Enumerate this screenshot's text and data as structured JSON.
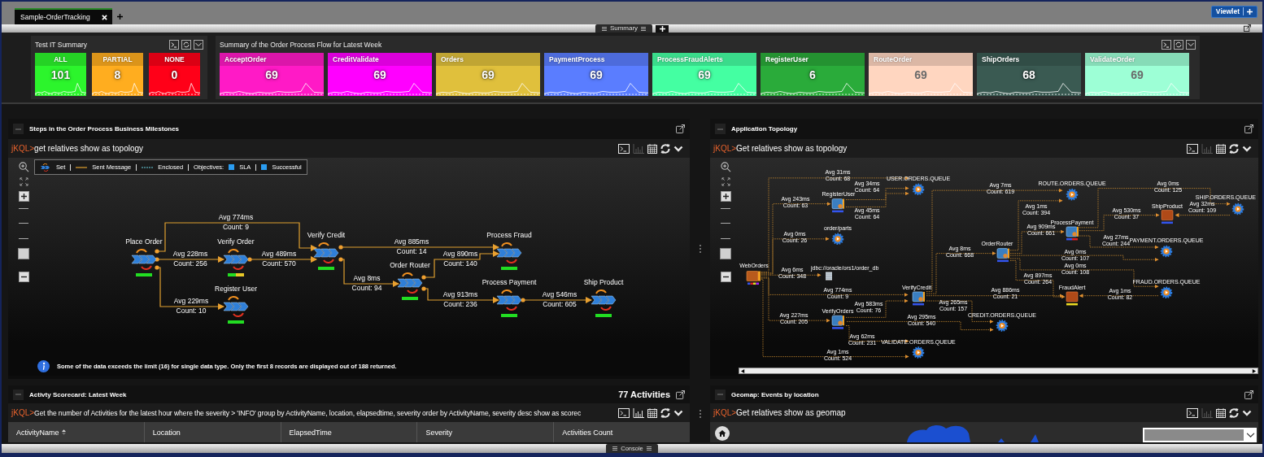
{
  "tabs": [
    {
      "label": "Sample-OrderTracking",
      "selected": true
    }
  ],
  "viewlet_button": "Viewlet",
  "layout_tab": "Summary",
  "summary": {
    "it": {
      "title": "Test IT Summary",
      "tiles": [
        {
          "label": "ALL",
          "value": "101",
          "color": "#2cf52c"
        },
        {
          "label": "PARTIAL",
          "value": "8",
          "color": "#ffad1f"
        },
        {
          "label": "NONE",
          "value": "0",
          "color": "#ff0018"
        }
      ]
    },
    "flow": {
      "title": "Summary of the Order Process Flow for Latest Week",
      "tiles": [
        {
          "label": "AcceptOrder",
          "value": "69",
          "color": "#ff1ac6"
        },
        {
          "label": "CreditValidate",
          "value": "69",
          "color": "#ff00ff"
        },
        {
          "label": "Orders",
          "value": "69",
          "color": "#e0c03c"
        },
        {
          "label": "PaymentProcess",
          "value": "69",
          "color": "#5a7dff"
        },
        {
          "label": "ProcessFraudAlerts",
          "value": "69",
          "color": "#44ffa2"
        },
        {
          "label": "RegisterUser",
          "value": "6",
          "color": "#2aab3a"
        },
        {
          "label": "RouteOrder",
          "value": "69",
          "color": "#ffd6c0"
        },
        {
          "label": "ShipOrders",
          "value": "68",
          "color": "#3a5a52"
        },
        {
          "label": "ValidateOrder",
          "value": "69",
          "color": "#9dffd6"
        }
      ]
    }
  },
  "panels": [
    {
      "kind": "milestones",
      "title": "Steps in the Order Process Business Milestones",
      "prompt": "jKQL>",
      "query": "get relatives show as topology",
      "toolbar": [
        {
          "kind": "terminal",
          "disabled": false
        },
        {
          "kind": "chart",
          "disabled": true
        },
        {
          "kind": "calendar",
          "disabled": false
        },
        {
          "kind": "refresh",
          "disabled": false
        },
        {
          "kind": "chevron",
          "disabled": false
        }
      ],
      "zoom": {
        "level": 0.15
      },
      "legend": [
        {
          "kind": "set",
          "label": "Set"
        },
        {
          "kind": "line",
          "label": "Sent Message"
        },
        {
          "kind": "dashed",
          "label": "Enclosed"
        },
        {
          "kind": "heading",
          "label": "Objectives:"
        },
        {
          "kind": "square",
          "label": "SLA"
        },
        {
          "kind": "square",
          "label": "Successful"
        }
      ],
      "nodes": [
        {
          "label": "Place Order",
          "status_bar": [
            {
              "color": "#22dd22"
            }
          ]
        },
        {
          "label": "Verify Order",
          "status_bar": [
            {
              "color": "#22dd22"
            },
            {
              "color": "#e8c828"
            }
          ]
        },
        {
          "label": "Register User",
          "status_bar": [
            {
              "color": "#22dd22"
            }
          ]
        },
        {
          "label": "Verify Credit",
          "status_bar": [
            {
              "color": "#22dd22"
            }
          ]
        },
        {
          "label": "Order Router",
          "status_bar": [
            {
              "color": "#22dd22"
            }
          ]
        },
        {
          "label": "Process Fraud",
          "status_bar": [
            {
              "color": "#22dd22"
            }
          ]
        },
        {
          "label": "Process Payment",
          "status_bar": [
            {
              "color": "#22dd22"
            }
          ]
        },
        {
          "label": "Ship Product",
          "status_bar": [
            {
              "color": "#22dd22"
            }
          ]
        }
      ],
      "edges": [
        {
          "avg": "Avg 774ms",
          "count": "Count: 9"
        },
        {
          "avg": "Avg 228ms",
          "count": "Count: 256"
        },
        {
          "avg": "Avg 229ms",
          "count": "Count: 10"
        },
        {
          "avg": "Avg 489ms",
          "count": "Count: 570"
        },
        {
          "avg": "Avg 885ms",
          "count": "Count: 14"
        },
        {
          "avg": "Avg 8ms",
          "count": "Count: 94"
        },
        {
          "avg": "Avg 890ms",
          "count": "Count: 140"
        },
        {
          "avg": "Avg 913ms",
          "count": "Count: 236"
        },
        {
          "avg": "Avg 546ms",
          "count": "Count: 605"
        }
      ],
      "info": "Some of the data exceeds the limit (16) for single data type. Only the first 8 records are displayed out of 188 returned."
    },
    {
      "kind": "topology",
      "title": "Application Topology",
      "prompt": "jKQL>",
      "query": "Get relatives show as topology",
      "toolbar": [
        {
          "kind": "terminal",
          "disabled": false
        },
        {
          "kind": "chart",
          "disabled": true
        },
        {
          "kind": "calendar",
          "disabled": false
        },
        {
          "kind": "refresh",
          "disabled": false
        },
        {
          "kind": "chevron",
          "disabled": false
        }
      ],
      "zoom": {
        "level": 0.15
      },
      "nodes": [
        {
          "label": "WebOrders",
          "kind": "start",
          "status_bar": [
            {
              "color": "#3355ee"
            },
            {
              "color": "#dd2222"
            },
            {
              "color": "#dddd22"
            },
            {
              "color": "#aa22ff"
            }
          ]
        },
        {
          "label": "RegisterUser",
          "kind": "process",
          "status_bar": [
            {
              "color": "#3355ee"
            }
          ]
        },
        {
          "label": "order/parts",
          "kind": "queue"
        },
        {
          "label": "jdbc://oracle/ors1/order_db",
          "kind": "database"
        },
        {
          "label": "VerifyOrders",
          "kind": "process",
          "status_bar": [
            {
              "color": "#3355ee"
            }
          ]
        },
        {
          "label": "USER.ORDERS.QUEUE",
          "kind": "queue"
        },
        {
          "label": "VerifyCredit",
          "kind": "process",
          "status_bar": [
            {
              "color": "#3355ee"
            }
          ]
        },
        {
          "label": "VALIDATE.ORDERS.QUEUE",
          "kind": "queue"
        },
        {
          "label": "OrderRouter",
          "kind": "process",
          "status_bar": [
            {
              "color": "#3355ee"
            }
          ]
        },
        {
          "label": "CREDIT.ORDERS.QUEUE",
          "kind": "queue"
        },
        {
          "label": "ROUTE.ORDERS.QUEUE",
          "kind": "queue"
        },
        {
          "label": "ProcessPayment",
          "kind": "process",
          "status_bar": [
            {
              "color": "#3355ee"
            },
            {
              "color": "#dd2222"
            }
          ]
        },
        {
          "label": "FraudAlert",
          "kind": "end",
          "status_bar": [
            {
              "color": "#eedd22"
            }
          ]
        },
        {
          "label": "ShipProduct",
          "kind": "end",
          "status_bar": [
            {
              "color": "#3355ee"
            }
          ]
        },
        {
          "label": "PAYMENT.ORDERS.QUEUE",
          "kind": "queue"
        },
        {
          "label": "FRAUD.ORDERS.QUEUE",
          "kind": "queue"
        },
        {
          "label": "SHIP.ORDERS.QUEUE",
          "kind": "queue"
        }
      ],
      "edges": [
        {
          "avg": "Avg 31ms",
          "count": "Count: 68"
        },
        {
          "avg": "Avg 243ms",
          "count": "Count: 63"
        },
        {
          "avg": "Avg 34ms",
          "count": "Count: 64"
        },
        {
          "avg": "Avg 45ms",
          "count": "Count: 64"
        },
        {
          "avg": "Avg 0ms",
          "count": "Count: 26"
        },
        {
          "avg": "Avg 6ms",
          "count": "Count: 348"
        },
        {
          "avg": "Avg 774ms",
          "count": "Count: 9"
        },
        {
          "avg": "Avg 227ms",
          "count": "Count: 205"
        },
        {
          "avg": "Avg 1ms",
          "count": "Count: 524"
        },
        {
          "avg": "Avg 583ms",
          "count": "Count: 76"
        },
        {
          "avg": "Avg 295ms",
          "count": "Count: 540"
        },
        {
          "avg": "Avg 62ms",
          "count": "Count: 231"
        },
        {
          "avg": "Avg 7ms",
          "count": "Count: 619"
        },
        {
          "avg": "Avg 8ms",
          "count": "Count: 668"
        },
        {
          "avg": "Avg 265ms",
          "count": "Count: 157"
        },
        {
          "avg": "Avg 886ms",
          "count": "Count: 21"
        },
        {
          "avg": "Avg 1ms",
          "count": "Count: 394"
        },
        {
          "avg": "Avg 909ms",
          "count": "Count: 661"
        },
        {
          "avg": "Avg 0ms",
          "count": "Count: 107"
        },
        {
          "avg": "Avg 0ms",
          "count": "Count: 108"
        },
        {
          "avg": "Avg 897ms",
          "count": "Count: 264"
        },
        {
          "avg": "Avg 0ms",
          "count": "Count: 125"
        },
        {
          "avg": "Avg 530ms",
          "count": "Count: 37"
        },
        {
          "avg": "Avg 27ms",
          "count": "Count: 244"
        },
        {
          "avg": "Avg 32ms",
          "count": "Count: 109"
        },
        {
          "avg": "Avg 1ms",
          "count": "Count: 82"
        }
      ]
    },
    {
      "kind": "table",
      "title": "Activty Scorecard: Latest Week",
      "count": "77 Activities",
      "prompt": "jKQL>",
      "query": "Get the number of Activities for the latest hour where the severity > 'INFO' group by ActivityName, location, elapsedtime, severity order by ActivityName, severity desc show as scorec",
      "toolbar": [
        {
          "kind": "terminal",
          "disabled": false
        },
        {
          "kind": "chart",
          "disabled": false
        },
        {
          "kind": "calendar",
          "disabled": false
        },
        {
          "kind": "refresh",
          "disabled": false
        },
        {
          "kind": "chevron",
          "disabled": false
        }
      ],
      "columns": [
        {
          "label": "ActivityName",
          "sorted": true
        },
        {
          "label": "Location",
          "sorted": false
        },
        {
          "label": "ElapsedTime",
          "sorted": false
        },
        {
          "label": "Severity",
          "sorted": false
        },
        {
          "label": "Activities Count",
          "sorted": false
        }
      ]
    },
    {
      "kind": "geomap",
      "title": "Geomap: Events by location",
      "prompt": "jKQL>",
      "query": "Get relatives show as geomap",
      "toolbar": [
        {
          "kind": "terminal",
          "disabled": false
        },
        {
          "kind": "chart",
          "disabled": true
        },
        {
          "kind": "calendar",
          "disabled": false
        },
        {
          "kind": "refresh",
          "disabled": false
        },
        {
          "kind": "chevron",
          "disabled": false
        }
      ]
    }
  ],
  "console_tab": "Console"
}
